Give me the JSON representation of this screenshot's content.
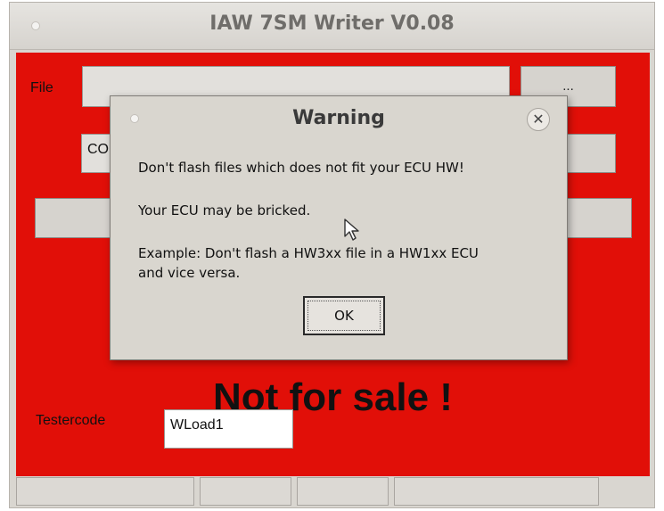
{
  "window": {
    "title": "IAW 7SM Writer V0.08"
  },
  "main": {
    "file_label": "File",
    "file_path": "",
    "browse_label": "...",
    "combo_value": "CO",
    "big_text": "Not for sale !",
    "testercode_label": "Testercode",
    "testercode_value": "WLoad1",
    "background_color": "#e10f08"
  },
  "dialog": {
    "title": "Warning",
    "close_icon": "close-icon",
    "lines": [
      "Don't flash files which does not fit your ECU HW!",
      "Your ECU may be bricked.",
      "Example: Don't flash a HW3xx file in a HW1xx ECU",
      "and vice versa."
    ],
    "ok_label": "OK"
  },
  "statusbar": {
    "segments": [
      "",
      "",
      "",
      ""
    ]
  }
}
